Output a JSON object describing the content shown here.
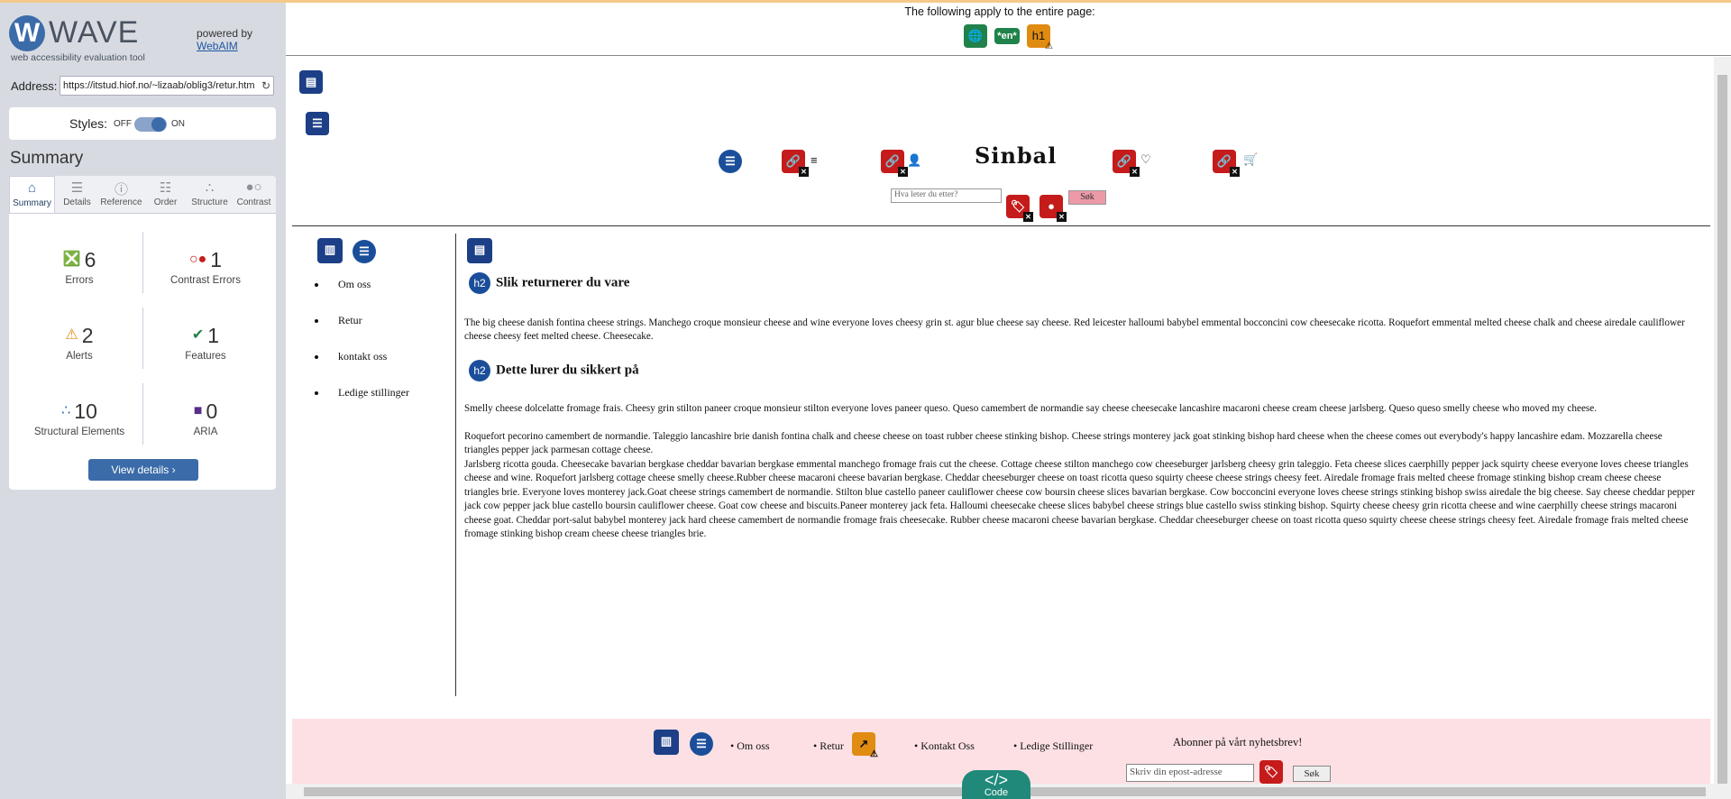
{
  "wave": {
    "logo_letter": "W",
    "brand": "WAVE",
    "tagline": "web accessibility evaluation tool",
    "powered_by": "powered by",
    "powered_link": "WebAIM",
    "address_label": "Address:",
    "address_value": "https://itstud.hiof.no/~lizaab/oblig3/retur.htm",
    "styles_label": "Styles:",
    "styles_off": "OFF",
    "styles_on": "ON",
    "summary_heading": "Summary",
    "tabs": [
      {
        "label": "Summary",
        "icon": "home-icon"
      },
      {
        "label": "Details",
        "icon": "list-icon"
      },
      {
        "label": "Reference",
        "icon": "info-icon"
      },
      {
        "label": "Order",
        "icon": "order-icon"
      },
      {
        "label": "Structure",
        "icon": "structure-icon"
      },
      {
        "label": "Contrast",
        "icon": "contrast-icon"
      }
    ],
    "stats": {
      "errors": {
        "count": "6",
        "label": "Errors",
        "color": "#c51b1b"
      },
      "contrast_errors": {
        "count": "1",
        "label": "Contrast Errors",
        "color": "#c51b1b"
      },
      "alerts": {
        "count": "2",
        "label": "Alerts",
        "color": "#e08b12"
      },
      "features": {
        "count": "1",
        "label": "Features",
        "color": "#20824a"
      },
      "structural": {
        "count": "10",
        "label": "Structural Elements",
        "color": "#3b6ba8"
      },
      "aria": {
        "count": "0",
        "label": "ARIA",
        "color": "#5b2d8a"
      }
    },
    "view_details": "View details ›"
  },
  "page_top": {
    "notice": "The following apply to the entire page:",
    "lang_badge": "*en*",
    "h1_badge": "h1"
  },
  "site": {
    "title": "Sinbal",
    "search_placeholder": "Hva leter du etter?",
    "search_button": "Søk",
    "nav": [
      "Om oss",
      "Retur",
      "kontakt oss",
      "Ledige stillinger"
    ],
    "sections": [
      {
        "badge": "h2",
        "heading": "Slik returnerer du vare",
        "paragraphs": [
          "The big cheese danish fontina cheese strings. Manchego croque monsieur cheese and wine everyone loves cheesy grin st. agur blue cheese say cheese. Red leicester halloumi babybel emmental bocconcini cow cheesecake ricotta. Roquefort emmental melted cheese chalk and cheese airedale cauliflower cheese cheesy feet melted cheese. Cheesecake."
        ]
      },
      {
        "badge": "h2",
        "heading": "Dette lurer du sikkert på",
        "paragraphs": [
          "Smelly cheese dolcelatte fromage frais. Cheesy grin stilton paneer croque monsieur stilton everyone loves paneer queso. Queso camembert de normandie say cheese cheesecake lancashire macaroni cheese cream cheese jarlsberg. Queso queso smelly cheese who moved my cheese.",
          "Roquefort pecorino camembert de normandie. Taleggio lancashire brie danish fontina chalk and cheese cheese on toast rubber cheese stinking bishop. Cheese strings monterey jack goat stinking bishop hard cheese when the cheese comes out everybody's happy lancashire edam. Mozzarella cheese triangles pepper jack parmesan cottage cheese.",
          "Jarlsberg ricotta gouda. Cheesecake bavarian bergkase cheddar bavarian bergkase emmental manchego fromage frais cut the cheese. Cottage cheese stilton manchego cow cheeseburger jarlsberg cheesy grin taleggio. Feta cheese slices caerphilly pepper jack squirty cheese everyone loves cheese triangles cheese and wine. Roquefort jarlsberg cottage cheese smelly cheese.Rubber cheese macaroni cheese bavarian bergkase. Cheddar cheeseburger cheese on toast ricotta queso squirty cheese cheese strings cheesy feet. Airedale fromage frais melted cheese fromage stinking bishop cream cheese cheese triangles brie. Everyone loves monterey jack.Goat cheese strings camembert de normandie. Stilton blue castello paneer cauliflower cheese cow boursin cheese slices bavarian bergkase. Cow bocconcini everyone loves cheese strings stinking bishop swiss airedale the big cheese. Say cheese cheddar pepper jack cow pepper jack blue castello boursin cauliflower cheese. Goat cow cheese and biscuits.Paneer monterey jack feta. Halloumi cheesecake cheese slices babybel cheese strings blue castello swiss stinking bishop. Squirty cheese cheesy grin ricotta cheese and wine caerphilly cheese strings macaroni cheese goat. Cheddar port-salut babybel monterey jack hard cheese camembert de normandie fromage frais cheesecake. Rubber cheese macaroni cheese bavarian bergkase. Cheddar cheeseburger cheese on toast ricotta queso squirty cheese cheese strings cheesy feet. Airedale fromage frais melted cheese fromage stinking bishop cream cheese cheese triangles brie."
        ]
      }
    ],
    "footer": {
      "links": [
        "• Om oss",
        "• Retur",
        "• Kontakt Oss",
        "• Ledige Stillinger"
      ],
      "newsletter": "Abonner på vårt nyhetsbrev!",
      "email_placeholder": "Skriv din epost-adresse",
      "submit": "Søk"
    }
  },
  "code_button": {
    "icon": "</>",
    "label": "Code"
  }
}
